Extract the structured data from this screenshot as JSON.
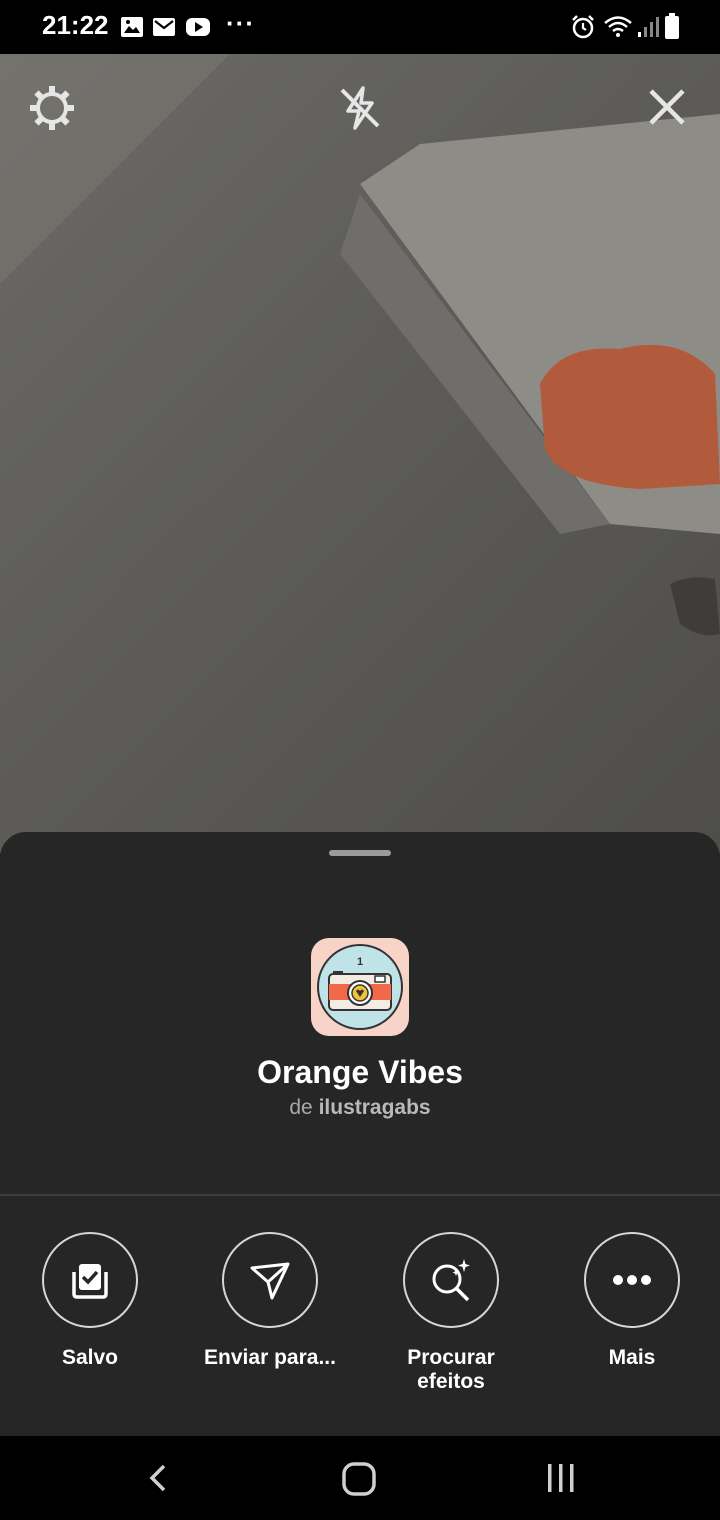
{
  "status_bar": {
    "time": "21:22",
    "left_icons": [
      "gallery-icon",
      "mail-icon",
      "youtube-icon",
      "more-notifications-icon"
    ],
    "more_glyph": "···",
    "right_icons": [
      "alarm-icon",
      "wifi-icon",
      "signal-icon",
      "battery-icon"
    ]
  },
  "camera": {
    "controls": [
      "settings-icon",
      "flash-off-icon",
      "close-icon"
    ]
  },
  "sheet": {
    "effect": {
      "title": "Orange Vibes",
      "author_prefix": "de",
      "author": "ilustragabs"
    },
    "actions": [
      {
        "label": "Salvo",
        "icon": "saved-icon"
      },
      {
        "label": "Enviar para...",
        "icon": "send-icon"
      },
      {
        "label": "Procurar efeitos",
        "icon": "browse-effects-icon"
      },
      {
        "label": "Mais",
        "icon": "more-icon"
      }
    ]
  },
  "nav_bar": {
    "buttons": [
      "back-icon",
      "home-icon",
      "recents-icon"
    ]
  },
  "colors": {
    "sheet_background": "#262626",
    "accent_orange": "#f06a4a",
    "thumb_background": "#f7d3c8"
  }
}
